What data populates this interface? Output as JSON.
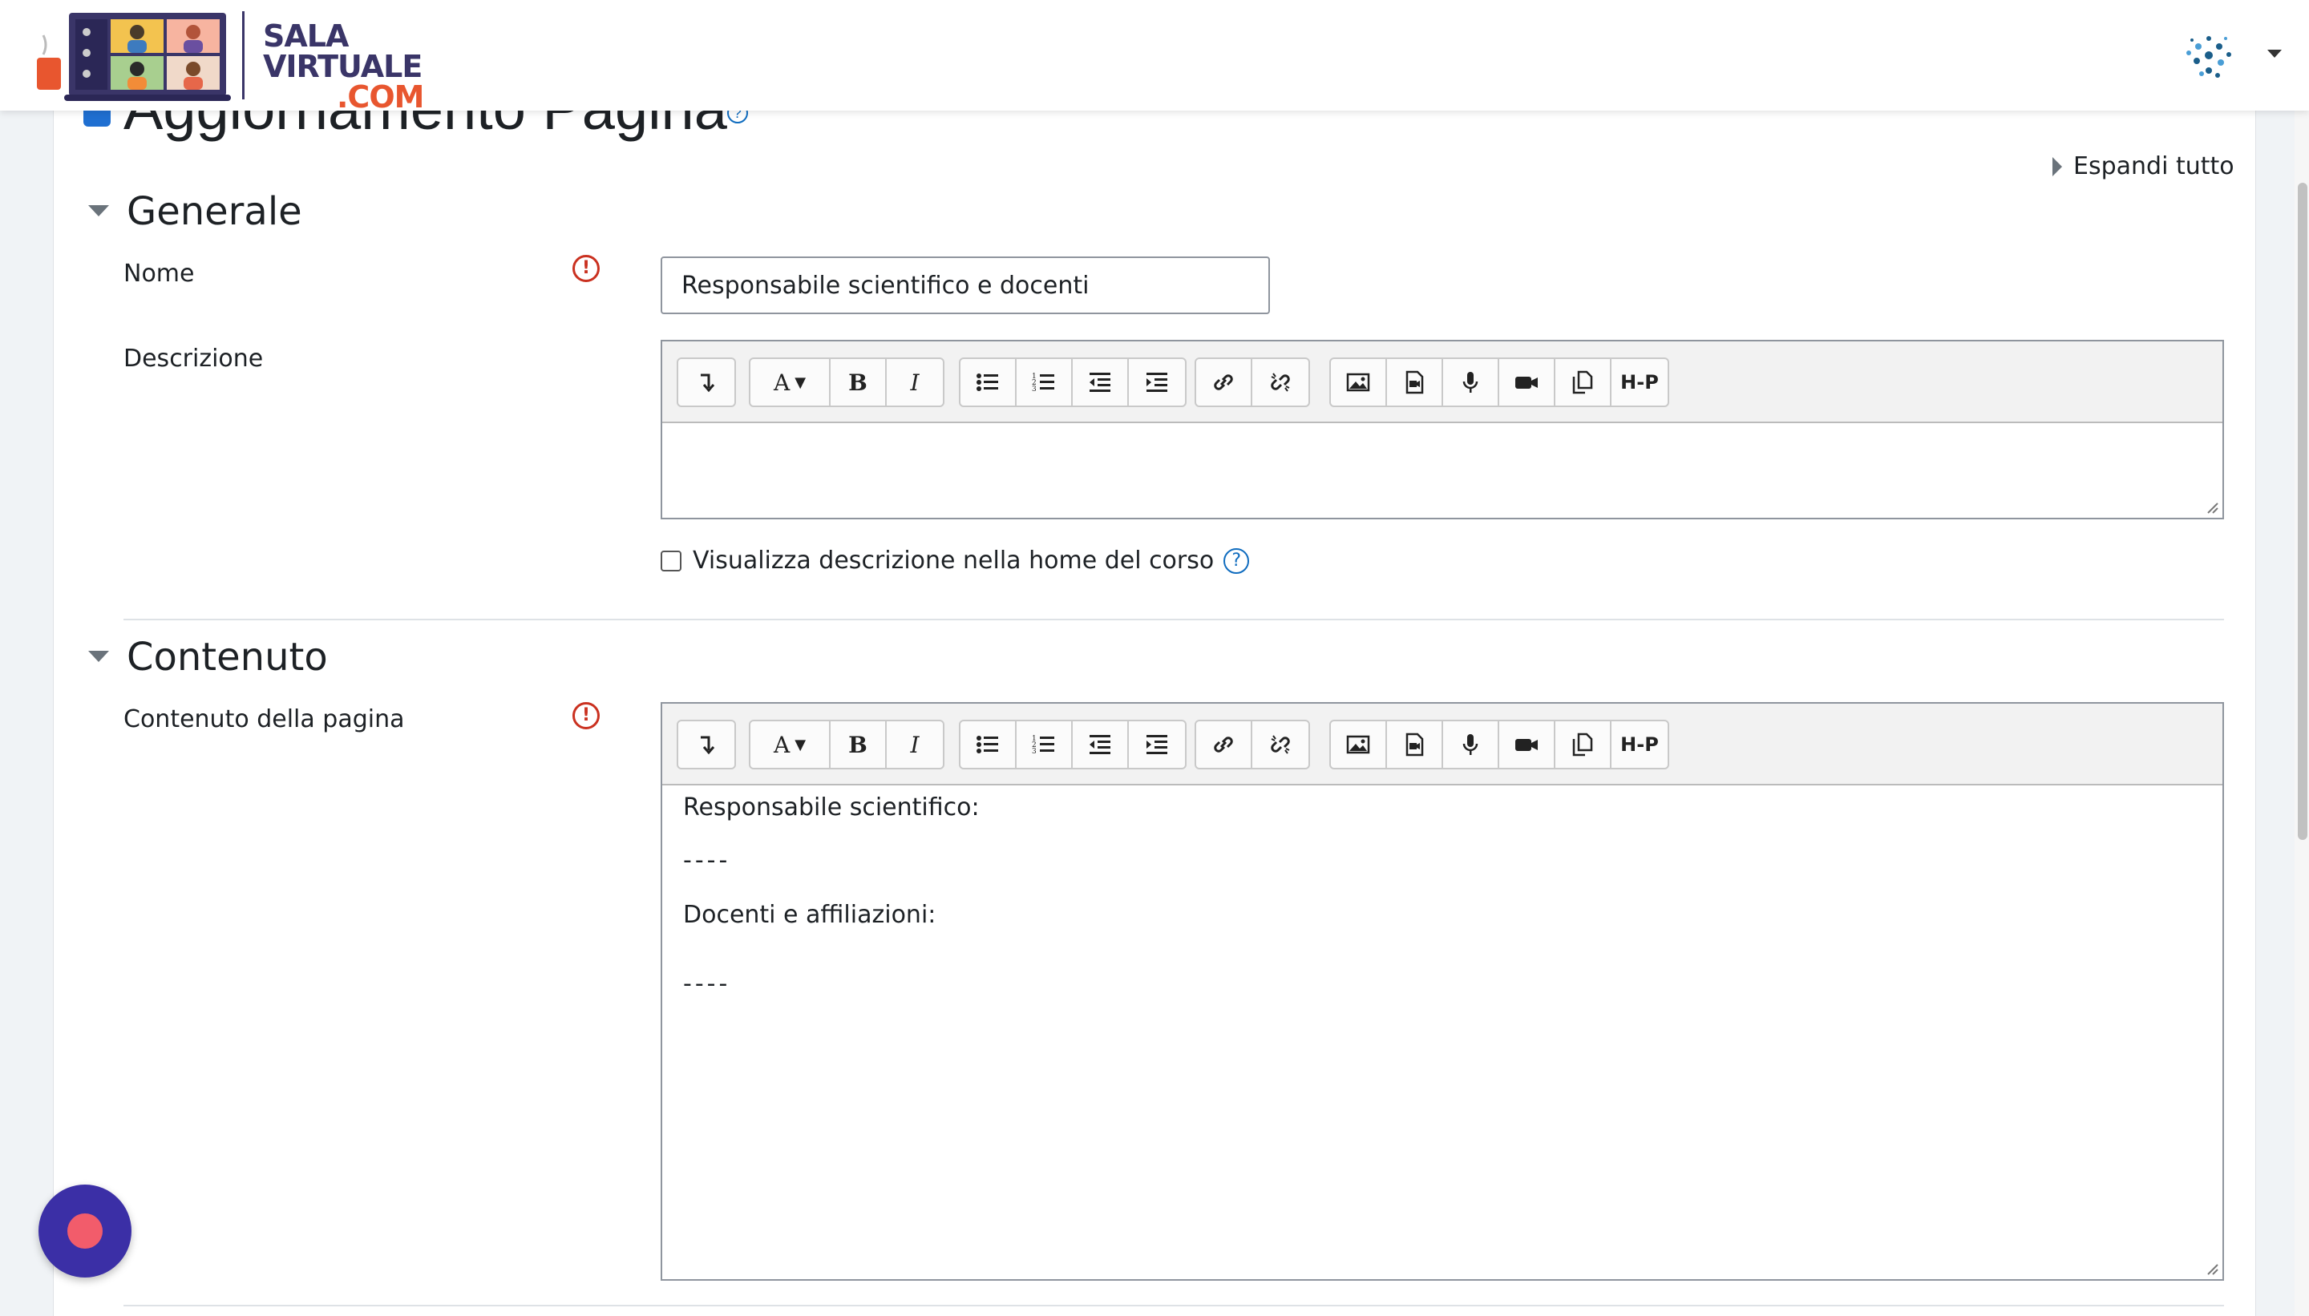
{
  "header": {
    "logo_line1": "SALA",
    "logo_line2": "VIRTUALE",
    "logo_line3": ".COM"
  },
  "page": {
    "title": "Aggiornamento Pagina",
    "help_glyph": "?",
    "expand_all": "Espandi tutto"
  },
  "sections": {
    "generale": {
      "title": "Generale"
    },
    "contenuto": {
      "title": "Contenuto"
    }
  },
  "fields": {
    "nome": {
      "label": "Nome",
      "value": "Responsabile scientifico e docenti"
    },
    "descrizione": {
      "label": "Descrizione"
    },
    "show_description": {
      "label": "Visualizza descrizione nella home del corso",
      "checked": false
    },
    "contenuto_pagina": {
      "label": "Contenuto della pagina",
      "lines": [
        "Responsabile scientifico:",
        "----",
        "Docenti e affiliazioni:",
        "----"
      ]
    }
  },
  "required_glyph": "!",
  "editor_toolbar": {
    "bold": "B",
    "italic": "I",
    "font": "A",
    "h5p": "H-P"
  },
  "icons": [
    "collapse-toolbar-icon",
    "font-style-icon",
    "bold-icon",
    "italic-icon",
    "unordered-list-icon",
    "ordered-list-icon",
    "outdent-icon",
    "indent-icon",
    "link-icon",
    "unlink-icon",
    "image-icon",
    "media-icon",
    "microphone-icon",
    "video-icon",
    "manage-files-icon",
    "h5p-icon"
  ],
  "colors": {
    "accent": "#0f6cbf",
    "required": "#ca3120",
    "fab": "#3b2fa6",
    "fab_dot": "#f25c6b"
  }
}
